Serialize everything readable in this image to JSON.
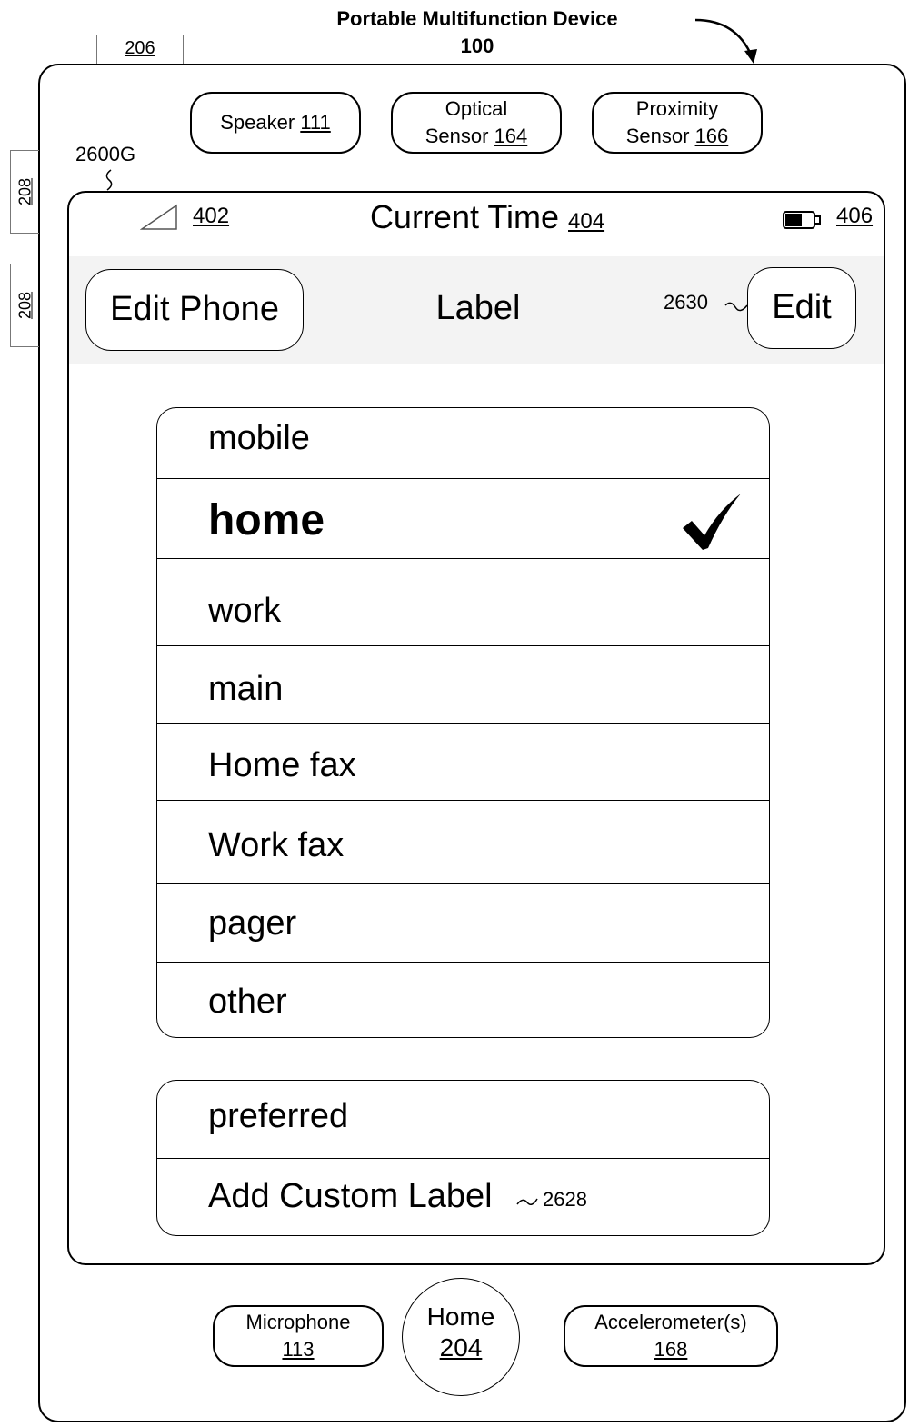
{
  "figure": {
    "title_line1": "Portable Multifunction Device",
    "title_line2": "100",
    "ref_206": "206",
    "ref_208": "208",
    "ref_2600g": "2600G"
  },
  "hardware": {
    "speaker": {
      "label": "Speaker",
      "ref": "111"
    },
    "optical": {
      "label_line1": "Optical",
      "label_line2": "Sensor",
      "ref": "164"
    },
    "proximity": {
      "label_line1": "Proximity",
      "label_line2": "Sensor",
      "ref": "166"
    },
    "microphone": {
      "label": "Microphone",
      "ref": "113"
    },
    "home": {
      "label": "Home",
      "ref": "204"
    },
    "accelerometer": {
      "label": "Accelerometer(s)",
      "ref": "168"
    }
  },
  "status_bar": {
    "signal_ref": "402",
    "time_label": "Current Time",
    "time_ref": "404",
    "battery_ref": "406"
  },
  "nav_bar": {
    "back_label": "Edit Phone",
    "title": "Label",
    "edit_label": "Edit",
    "edit_ref": "2630"
  },
  "labels_group": {
    "items": [
      "mobile",
      "home",
      "work",
      "main",
      "Home fax",
      "Work fax",
      "pager",
      "other"
    ],
    "selected": "home",
    "check_glyph": "✔"
  },
  "extra_group": {
    "preferred": "preferred",
    "add_custom": "Add Custom Label",
    "add_custom_ref": "2628"
  }
}
